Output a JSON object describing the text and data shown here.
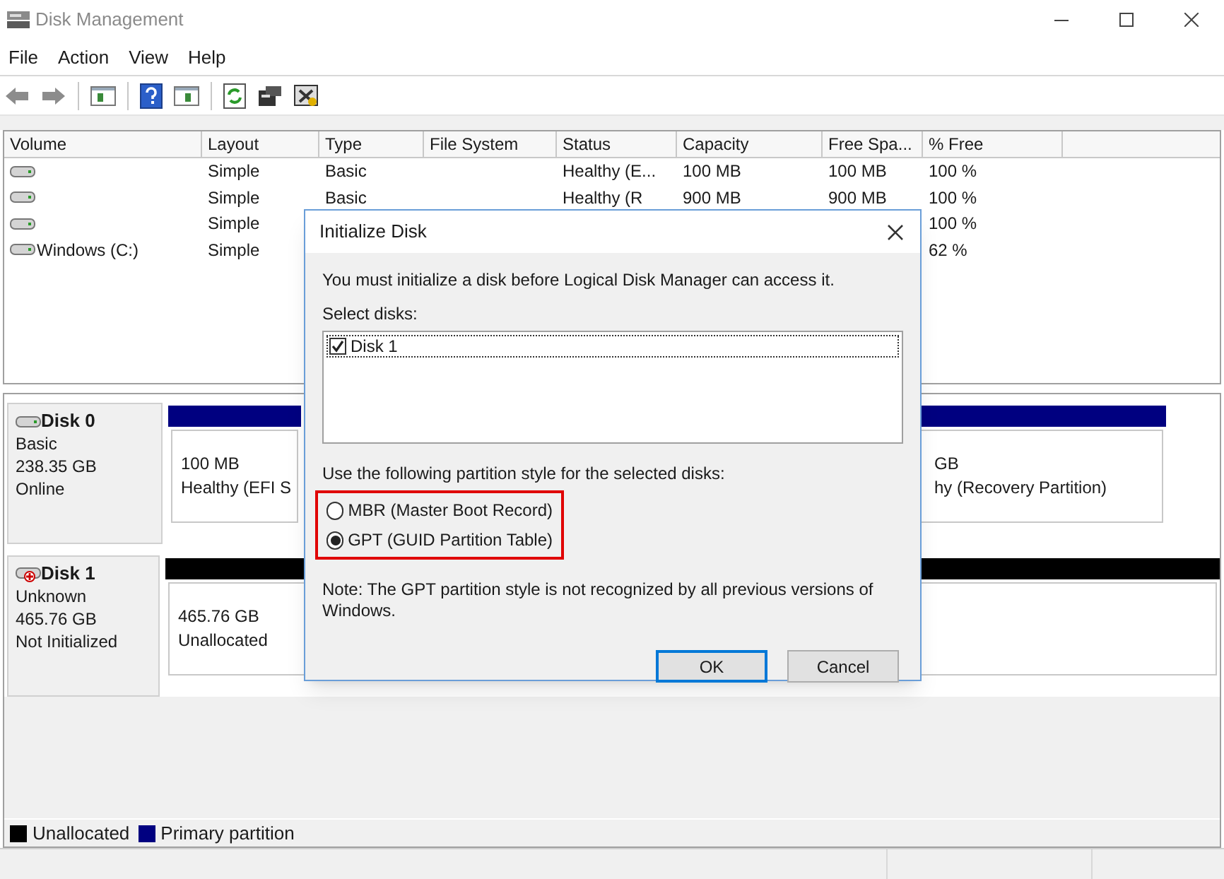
{
  "window": {
    "title": "Disk Management"
  },
  "menu": [
    {
      "label": "File"
    },
    {
      "label": "Action"
    },
    {
      "label": "View"
    },
    {
      "label": "Help"
    }
  ],
  "volume_table": {
    "columns": [
      {
        "label": "Volume"
      },
      {
        "label": "Layout"
      },
      {
        "label": "Type"
      },
      {
        "label": "File System"
      },
      {
        "label": "Status"
      },
      {
        "label": "Capacity"
      },
      {
        "label": "Free Spa..."
      },
      {
        "label": "% Free"
      }
    ],
    "rows": [
      {
        "layout": "Simple",
        "type": "Basic",
        "status": "Healthy (E...",
        "capacity": "100 MB",
        "free_space": "100 MB",
        "percent_free": "100 %"
      },
      {
        "layout": "Simple",
        "type": "Basic",
        "status": "Healthy (R",
        "capacity": "900 MB",
        "free_space": "900 MB",
        "percent_free": "100 %"
      },
      {
        "layout": "Simple",
        "percent_free": "100 %"
      },
      {
        "volume": "Windows (C:)",
        "layout": "Simple",
        "percent_free": "62 %"
      }
    ]
  },
  "disks": [
    {
      "name": "Disk 0",
      "kind": "online",
      "type": "Basic",
      "size": "238.35 GB",
      "status": "Online",
      "partitions": [
        {
          "lines": [
            "100 MB",
            "Healthy (EFI S"
          ],
          "color": "#000080"
        },
        {
          "lines": [
            "GB",
            "hy (Recovery Partition)"
          ],
          "color": "#000080"
        }
      ]
    },
    {
      "name": "Disk 1",
      "kind": "uninitialized",
      "type": "Unknown",
      "size": "465.76 GB",
      "status": "Not Initialized",
      "partitions": [
        {
          "lines": [
            "465.76 GB",
            "Unallocated"
          ],
          "color": "#000000"
        }
      ]
    }
  ],
  "legend": [
    {
      "label": "Unallocated",
      "color": "#000000"
    },
    {
      "label": "Primary partition",
      "color": "#000080"
    }
  ],
  "dialog": {
    "title": "Initialize Disk",
    "message": "You must initialize a disk before Logical Disk Manager can access it.",
    "select_label": "Select disks:",
    "disks": [
      {
        "label": "Disk 1",
        "checked": true,
        "selected": true
      }
    ],
    "style_label": "Use the following partition style for the selected disks:",
    "styles": [
      {
        "label": "MBR (Master Boot Record)",
        "selected": false
      },
      {
        "label": "GPT (GUID Partition Table)",
        "selected": true
      }
    ],
    "note": "Note: The GPT partition style is not recognized by all previous versions of Windows.",
    "buttons": [
      {
        "label": "OK",
        "default": true
      },
      {
        "label": "Cancel",
        "default": false
      }
    ]
  }
}
